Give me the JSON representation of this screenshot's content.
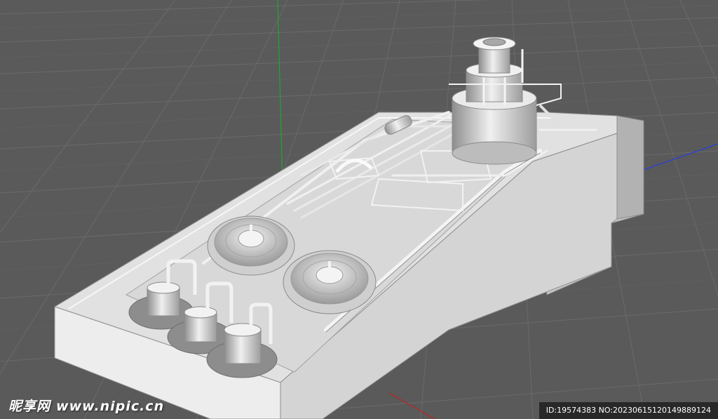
{
  "viewport": {
    "scene": "3d-industrial-plant-model",
    "grid": true,
    "axis_colors": {
      "y": "#1fa82a",
      "z": "#2a3fd8",
      "x": "#c0241e"
    },
    "background": "#5a5a5a"
  },
  "watermark": {
    "logo_cn": "昵享网",
    "logo_url": "www.nipic.cn",
    "image_id": "ID:19574383 NO:20230615120149889124"
  }
}
